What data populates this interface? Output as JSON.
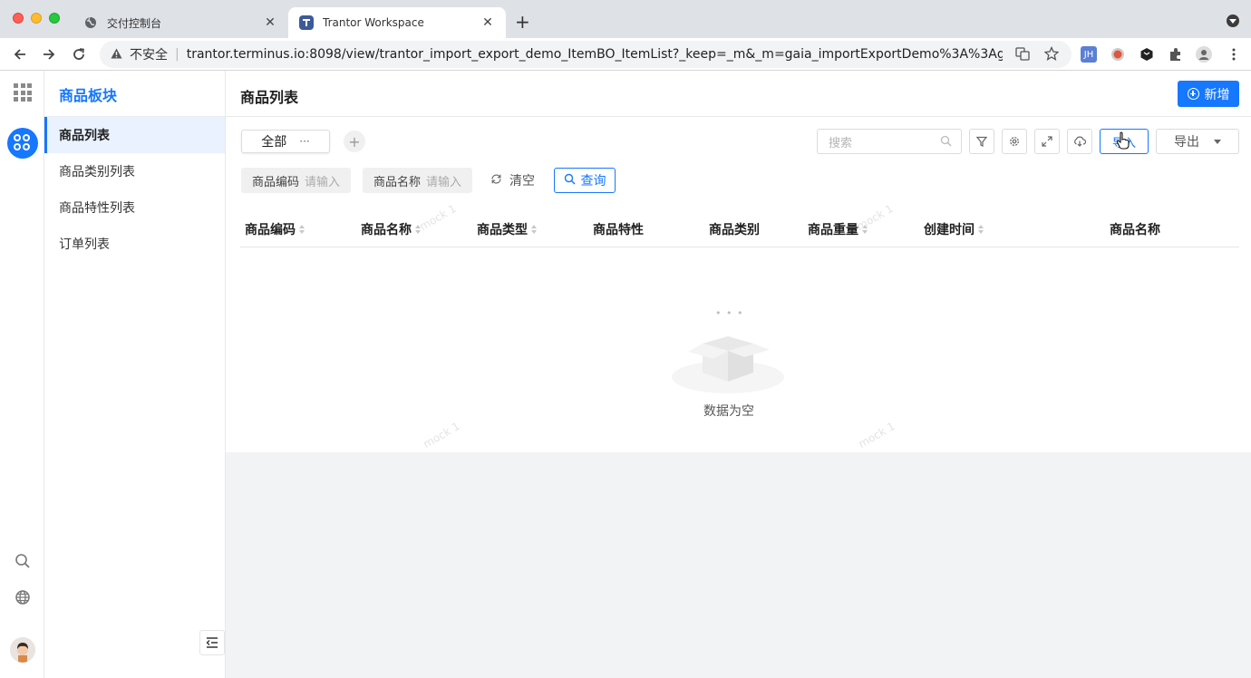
{
  "browser": {
    "tabs": [
      {
        "title": "交付控制台",
        "close": "✕"
      },
      {
        "title": "Trantor Workspace",
        "close": "✕"
      }
    ],
    "new_tab": "+",
    "security_label": "不安全",
    "url": "trantor.terminus.io:8098/view/trantor_import_export_demo_ItemBO_ItemList?_keep=_m&_m=gaia_importExportDemo%3A%3Agaia_imp...",
    "extension_jh": "JH"
  },
  "sidebar": {
    "module_title": "商品板块",
    "items": [
      {
        "label": "商品列表",
        "active": true
      },
      {
        "label": "商品类别列表",
        "active": false
      },
      {
        "label": "商品特性列表",
        "active": false
      },
      {
        "label": "订单列表",
        "active": false
      }
    ]
  },
  "header": {
    "title": "商品列表",
    "new_button": "新增"
  },
  "toolbar": {
    "view_tab": "全部",
    "view_tab_more": "···",
    "add_view": "+",
    "search_placeholder": "搜索",
    "import_label": "导入",
    "export_label": "导出"
  },
  "filters": [
    {
      "label": "商品编码",
      "placeholder": "请输入"
    },
    {
      "label": "商品名称",
      "placeholder": "请输入"
    }
  ],
  "actions": {
    "clear": "清空",
    "query": "查询"
  },
  "table": {
    "columns": [
      "商品编码",
      "商品名称",
      "商品类型",
      "商品特性",
      "商品类别",
      "商品重量",
      "创建时间",
      "商品名称"
    ],
    "rows": [],
    "empty_text": "数据为空",
    "empty_dots": "• • •"
  },
  "watermark": "mock 1",
  "colors": {
    "primary": "#1677ff",
    "sidebar_active_bg": "#eaf2ff",
    "page_bg": "#f2f3f5"
  }
}
